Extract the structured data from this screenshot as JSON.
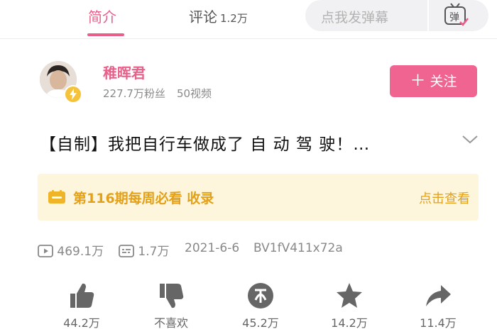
{
  "tabs": {
    "intro_label": "简介",
    "comments_label": "评论",
    "comments_count": "1.2万"
  },
  "danmaku": {
    "placeholder": "点我发弹幕",
    "button_label": "弹"
  },
  "uploader": {
    "name": "稚晖君",
    "followers": "227.7万粉丝",
    "videos": "50视频",
    "follow_label": "关注"
  },
  "video": {
    "title": "【自制】我把自行车做成了 自 动 驾 驶！…",
    "views": "469.1万",
    "danmaku_count": "1.7万",
    "date": "2021-6-6",
    "bvid": "BV1fV411x72a"
  },
  "weekly": {
    "text": "第116期每周必看 收录",
    "link": "点击查看"
  },
  "actions": {
    "like": "44.2万",
    "dislike": "不喜欢",
    "coin": "45.2万",
    "favorite": "14.2万",
    "share": "11.4万"
  },
  "colors": {
    "accent": "#e8608a",
    "follow_bg": "#f06492",
    "weekly_bg": "#fdf6dc",
    "weekly_text": "#e3a11b"
  }
}
